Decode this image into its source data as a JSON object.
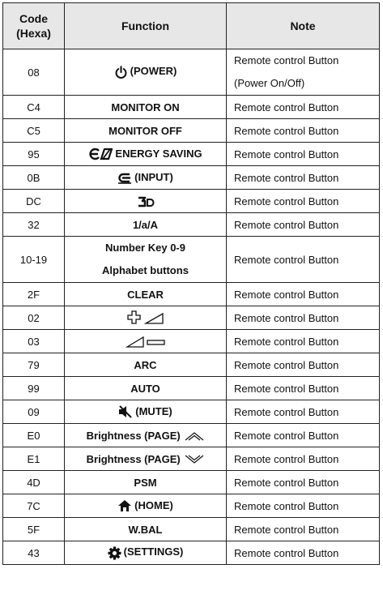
{
  "header": {
    "code": "Code\n(Hexa)",
    "function": "Function",
    "note": "Note"
  },
  "rows": [
    {
      "code": "08",
      "icon": "power-icon",
      "function": "(POWER)",
      "note_lines": [
        "Remote control Button",
        "(Power On/Off)"
      ]
    },
    {
      "code": "C4",
      "icon": "",
      "function": "MONITOR ON",
      "note": "Remote control Button"
    },
    {
      "code": "C5",
      "icon": "",
      "function": "MONITOR OFF",
      "note": "Remote control Button"
    },
    {
      "code": "95",
      "icon": "energy-saving-icon",
      "function": "ENERGY SAVING",
      "note": "Remote control Button"
    },
    {
      "code": "0B",
      "icon": "input-icon",
      "function": "(INPUT)",
      "note": "Remote control Button"
    },
    {
      "code": "DC",
      "icon": "3d-icon",
      "function": "",
      "note": "Remote control Button"
    },
    {
      "code": "32",
      "icon": "",
      "function": "1/a/A",
      "note": "Remote control Button"
    },
    {
      "code": "10-19",
      "icon": "",
      "function_lines": [
        "Number Key 0-9",
        "Alphabet buttons"
      ],
      "note": "Remote control Button"
    },
    {
      "code": "2F",
      "icon": "",
      "function": "CLEAR",
      "note": "Remote control Button"
    },
    {
      "code": "02",
      "icon": "volume-up-icon",
      "function": "",
      "note": "Remote control Button"
    },
    {
      "code": "03",
      "icon": "volume-down-icon",
      "function": "",
      "note": "Remote control Button"
    },
    {
      "code": "79",
      "icon": "",
      "function": "ARC",
      "note": "Remote control Button"
    },
    {
      "code": "99",
      "icon": "",
      "function": "AUTO",
      "note": "Remote control Button"
    },
    {
      "code": "09",
      "icon": "mute-icon",
      "function": "(MUTE)",
      "note": "Remote control Button"
    },
    {
      "code": "E0",
      "icon": "chevron-up-icon",
      "function": "Brightness (PAGE)",
      "note": "Remote control Button"
    },
    {
      "code": "E1",
      "icon": "chevron-down-icon",
      "function": "Brightness (PAGE)",
      "note": "Remote control Button"
    },
    {
      "code": "4D",
      "icon": "",
      "function": "PSM",
      "note": "Remote control Button"
    },
    {
      "code": "7C",
      "icon": "home-icon",
      "function": "(HOME)",
      "note": "Remote control Button"
    },
    {
      "code": "5F",
      "icon": "",
      "function": "W.BAL",
      "note": "Remote control Button"
    },
    {
      "code": "43",
      "icon": "settings-icon",
      "function": "(SETTINGS)",
      "note": "Remote control Button"
    }
  ]
}
